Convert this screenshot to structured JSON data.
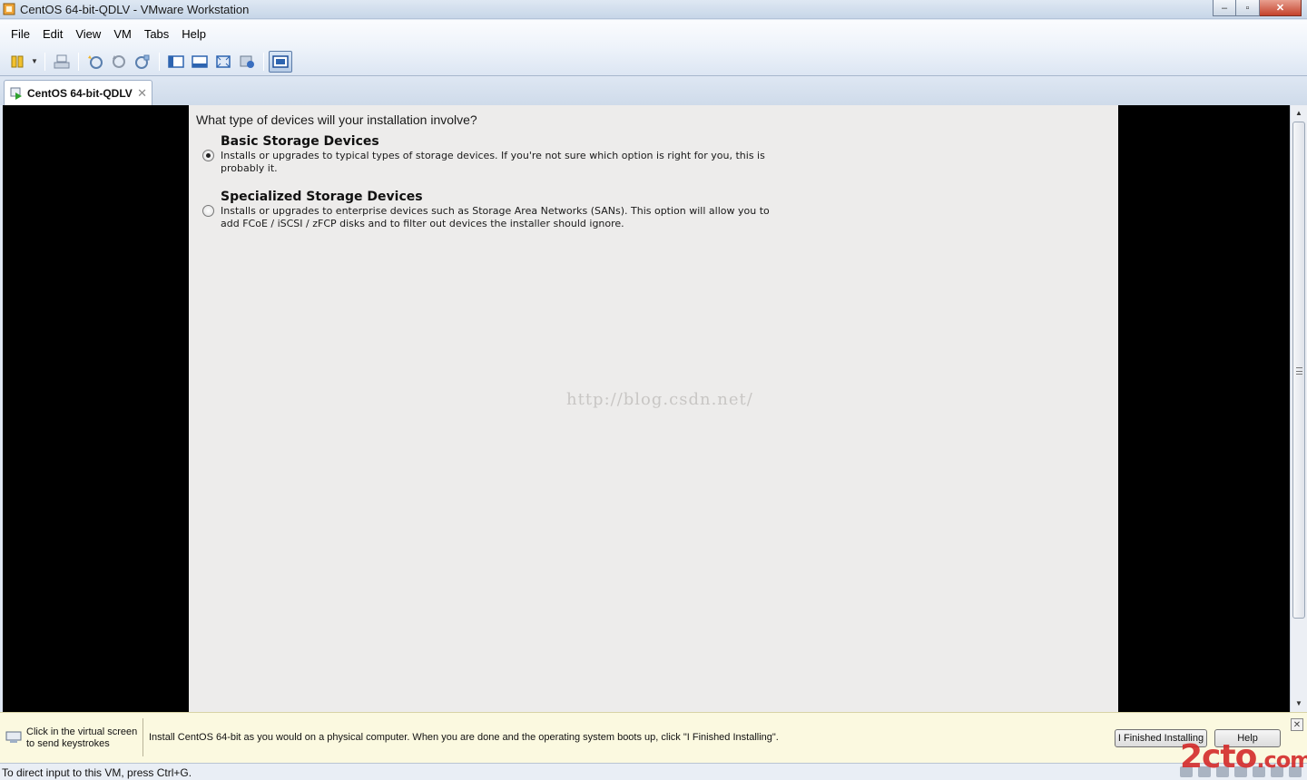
{
  "window": {
    "title": "CentOS 64-bit-QDLV - VMware Workstation",
    "controls": {
      "minimize": "–",
      "maximize": "▫",
      "close": "✕"
    }
  },
  "menu": [
    "File",
    "Edit",
    "View",
    "VM",
    "Tabs",
    "Help"
  ],
  "toolbar": {
    "icons": [
      "pause-icon",
      "send-ctrl-alt-del-icon",
      "take-snapshot-icon",
      "revert-snapshot-icon",
      "snapshot-manager-icon",
      "normal-view-icon",
      "quick-switch-icon",
      "full-screen-icon",
      "unity-icon",
      "console-view-icon"
    ]
  },
  "tab": {
    "label": "CentOS 64-bit-QDLV",
    "close": "✕"
  },
  "guest": {
    "question": "What type of devices will your installation involve?",
    "options": [
      {
        "title": "Basic Storage Devices",
        "description": "Installs or upgrades to typical types of storage devices.  If you're not sure which option is right for you, this is probably it.",
        "selected": true
      },
      {
        "title": "Specialized Storage Devices",
        "description": "Installs or upgrades to enterprise devices such as Storage Area Networks (SANs). This option will allow you to add FCoE / iSCSI / zFCP disks and to filter out devices the installer should ignore.",
        "selected": false
      }
    ],
    "watermark": "http://blog.csdn.net/"
  },
  "hint": {
    "click_text_line1": "Click in the virtual screen",
    "click_text_line2": "to send keystrokes",
    "message": "Install CentOS 64-bit as you would on a physical computer. When you are done and the operating system boots up, click \"I Finished Installing\".",
    "finished_button": "I Finished Installing",
    "help_button": "Help",
    "close": "✕"
  },
  "status": {
    "text": "To direct input to this VM, press Ctrl+G."
  },
  "brand": {
    "text": "2cto",
    "suffix": ".com"
  }
}
